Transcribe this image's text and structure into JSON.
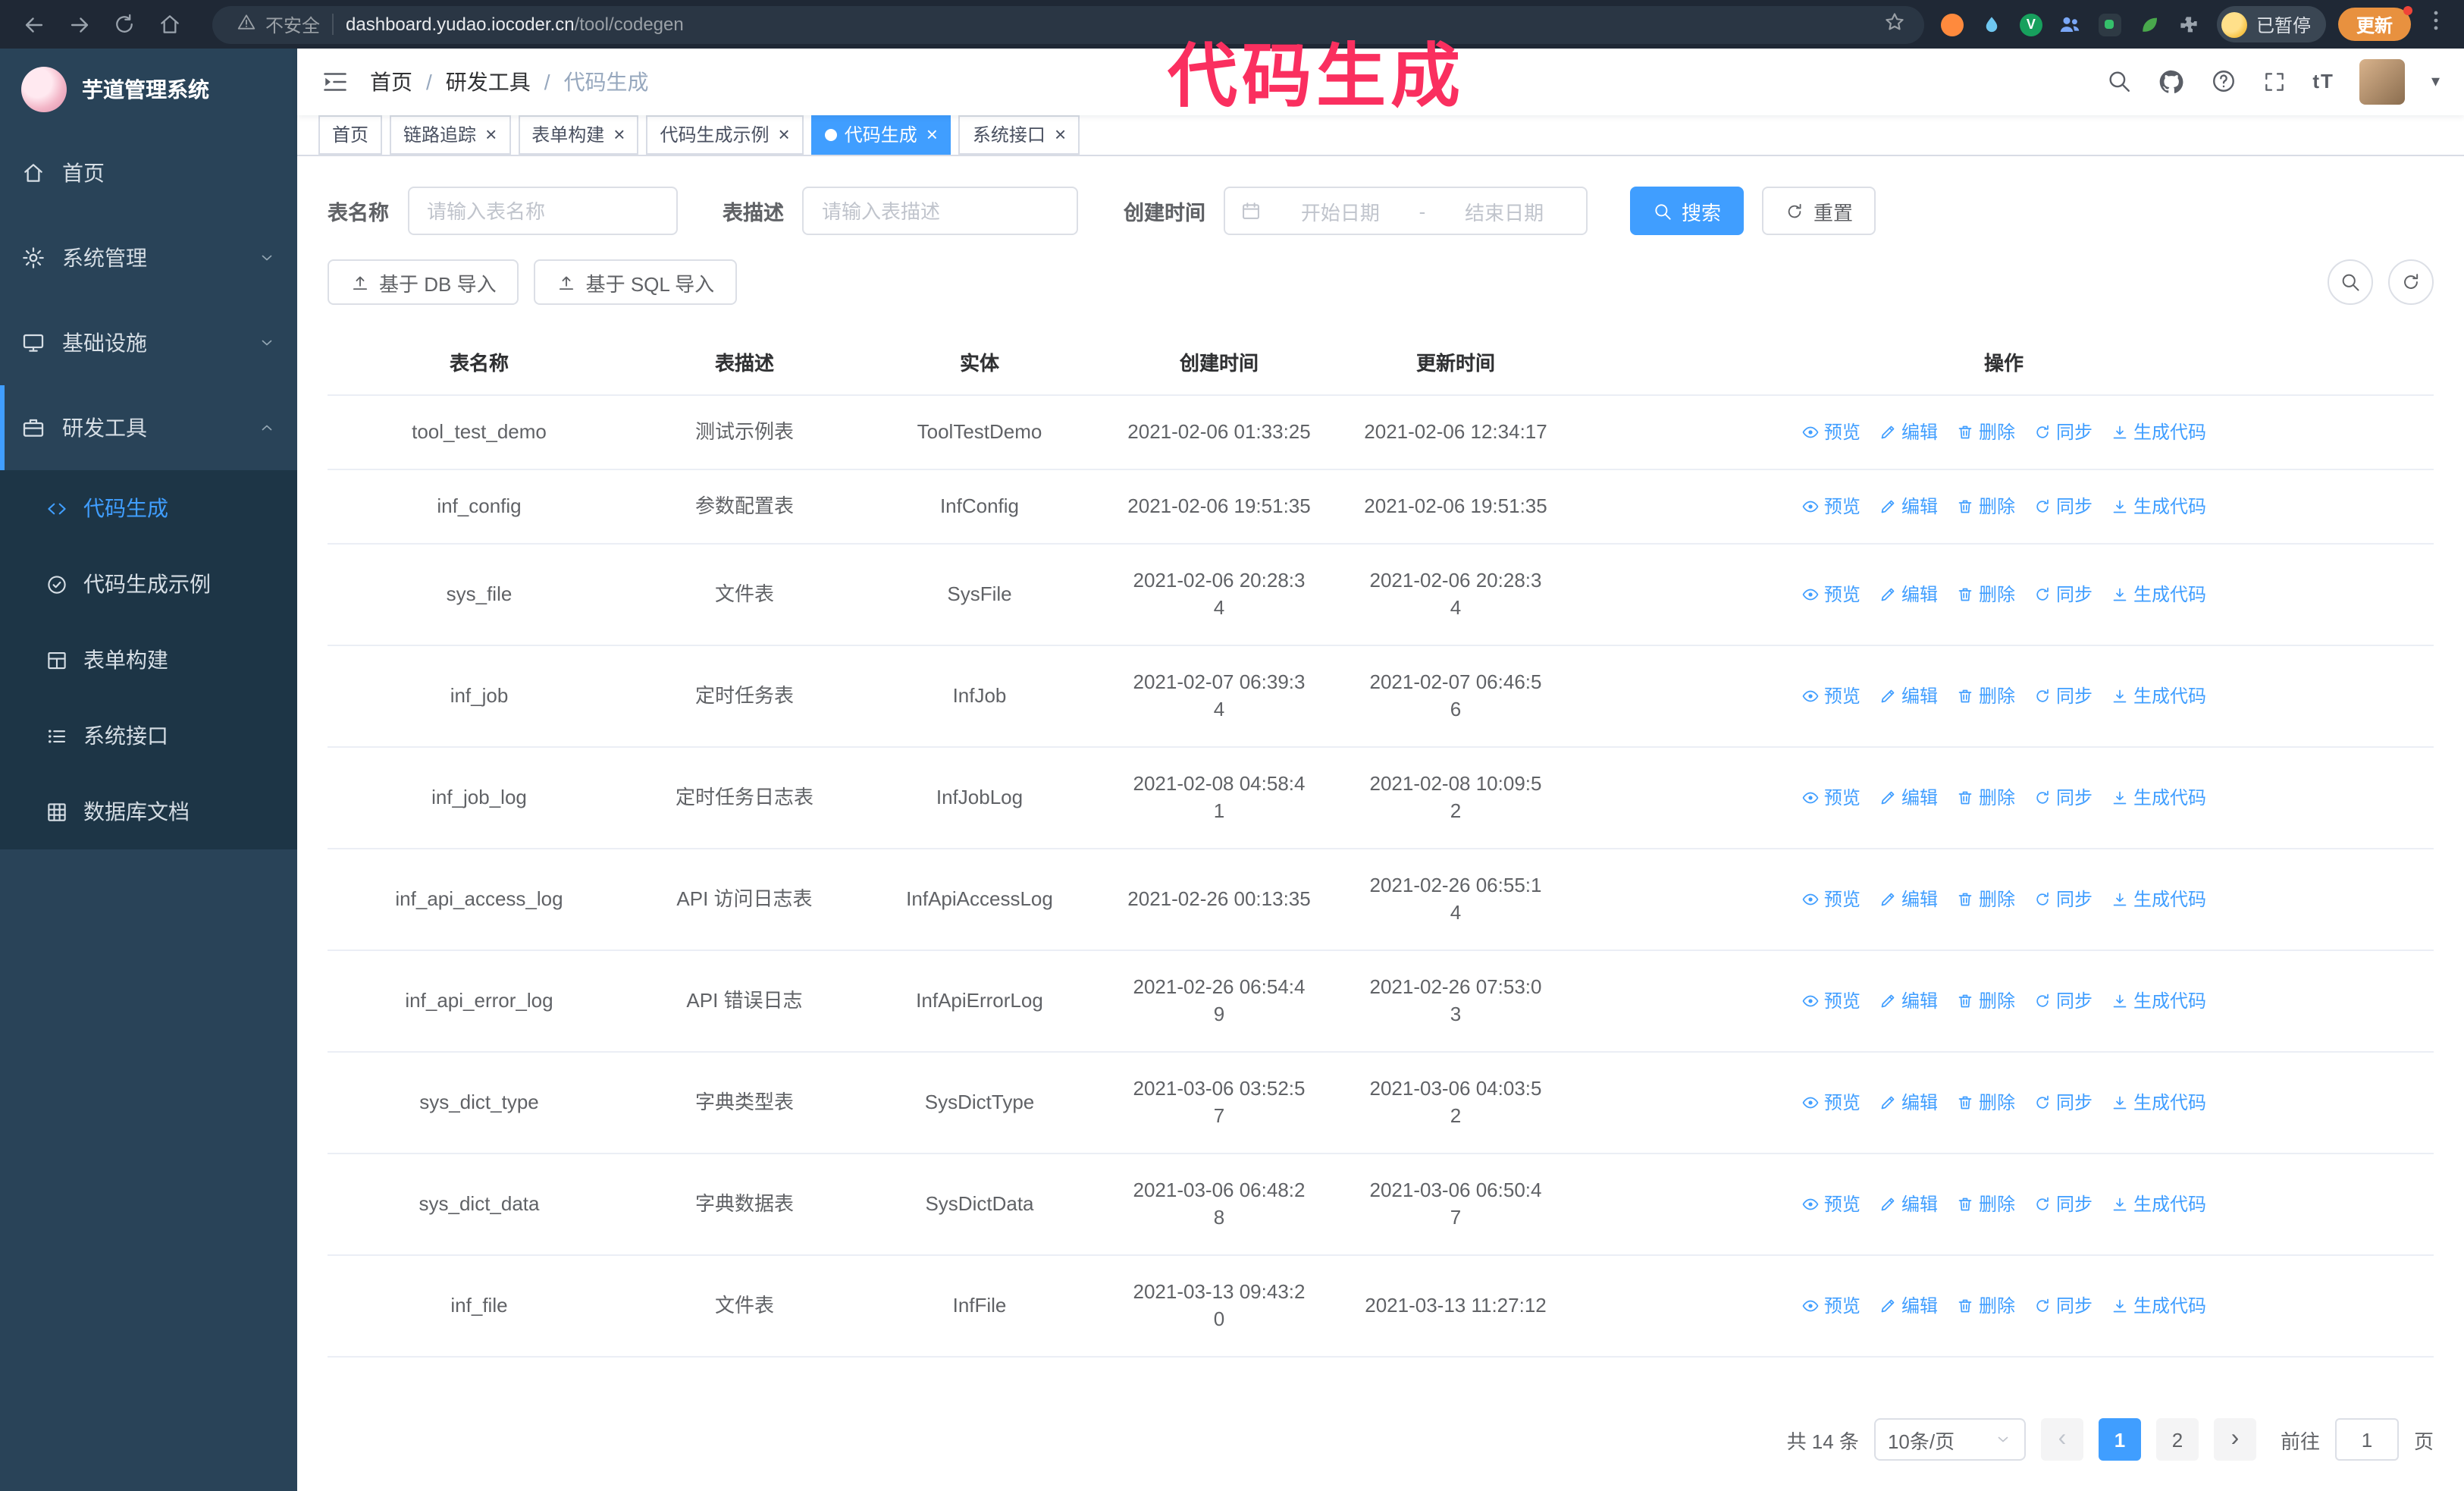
{
  "colors": {
    "accent": "#409eff",
    "annotation": "#fa2f5f",
    "update_button_bg": "#e8913f",
    "sidebar_bg": "#294358",
    "submenu_bg": "#1d3546"
  },
  "browser": {
    "security_label": "不安全",
    "url_host": "dashboard.yudao.iocoder.cn",
    "url_path": "/tool/codegen",
    "extension_icons": [
      "orange-circle-icon",
      "blue-drop-icon",
      "green-v-icon",
      "people-icon",
      "dark-card-icon",
      "leaf-icon",
      "puzzle-icon"
    ],
    "paused_badge": "已暂停",
    "update_button": "更新"
  },
  "annotation": {
    "text": "代码生成"
  },
  "sidebar": {
    "title": "芋道管理系统",
    "items": [
      {
        "label": "首页",
        "icon": "home"
      },
      {
        "label": "系统管理",
        "icon": "gear",
        "chevron": "down"
      },
      {
        "label": "基础设施",
        "icon": "monitor",
        "chevron": "down"
      },
      {
        "label": "研发工具",
        "icon": "briefcase",
        "chevron": "up",
        "active": true
      }
    ],
    "submenu": [
      {
        "label": "代码生成",
        "icon": "code",
        "active": true
      },
      {
        "label": "代码生成示例",
        "icon": "circle-check"
      },
      {
        "label": "表单构建",
        "icon": "form"
      },
      {
        "label": "系统接口",
        "icon": "api-list"
      },
      {
        "label": "数据库文档",
        "icon": "grid"
      }
    ]
  },
  "header": {
    "breadcrumb": [
      {
        "label": "首页"
      },
      {
        "label": "研发工具"
      },
      {
        "label": "代码生成",
        "current": true
      }
    ]
  },
  "tabs": [
    {
      "label": "首页",
      "closable": false,
      "active": false
    },
    {
      "label": "链路追踪",
      "closable": true,
      "active": false
    },
    {
      "label": "表单构建",
      "closable": true,
      "active": false
    },
    {
      "label": "代码生成示例",
      "closable": true,
      "active": false
    },
    {
      "label": "代码生成",
      "closable": true,
      "active": true
    },
    {
      "label": "系统接口",
      "closable": true,
      "active": false
    }
  ],
  "filters": {
    "table_name_label": "表名称",
    "table_name_placeholder": "请输入表名称",
    "table_desc_label": "表描述",
    "table_desc_placeholder": "请输入表描述",
    "create_time_label": "创建时间",
    "start_placeholder": "开始日期",
    "range_separator": "-",
    "end_placeholder": "结束日期",
    "search_button": "搜索",
    "reset_button": "重置"
  },
  "toolbar": {
    "import_db_label": "基于 DB 导入",
    "import_sql_label": "基于 SQL 导入"
  },
  "table": {
    "columns": [
      "表名称",
      "表描述",
      "实体",
      "创建时间",
      "更新时间",
      "操作"
    ],
    "action_labels": [
      "预览",
      "编辑",
      "删除",
      "同步",
      "生成代码"
    ],
    "rows": [
      {
        "name": "tool_test_demo",
        "desc": "测试示例表",
        "entity": "ToolTestDemo",
        "created": "2021-02-06 01:33:25",
        "updated": "2021-02-06 12:34:17"
      },
      {
        "name": "inf_config",
        "desc": "参数配置表",
        "entity": "InfConfig",
        "created": "2021-02-06 19:51:35",
        "updated": "2021-02-06 19:51:35"
      },
      {
        "name": "sys_file",
        "desc": "文件表",
        "entity": "SysFile",
        "created": "2021-02-06 20:28:3\n4",
        "updated": "2021-02-06 20:28:3\n4"
      },
      {
        "name": "inf_job",
        "desc": "定时任务表",
        "entity": "InfJob",
        "created": "2021-02-07 06:39:3\n4",
        "updated": "2021-02-07 06:46:5\n6"
      },
      {
        "name": "inf_job_log",
        "desc": "定时任务日志表",
        "entity": "InfJobLog",
        "created": "2021-02-08 04:58:4\n1",
        "updated": "2021-02-08 10:09:5\n2"
      },
      {
        "name": "inf_api_access_log",
        "desc": "API 访问日志表",
        "entity": "InfApiAccessLog",
        "created": "2021-02-26 00:13:35",
        "updated": "2021-02-26 06:55:1\n4"
      },
      {
        "name": "inf_api_error_log",
        "desc": "API 错误日志",
        "entity": "InfApiErrorLog",
        "created": "2021-02-26 06:54:4\n9",
        "updated": "2021-02-26 07:53:0\n3"
      },
      {
        "name": "sys_dict_type",
        "desc": "字典类型表",
        "entity": "SysDictType",
        "created": "2021-03-06 03:52:5\n7",
        "updated": "2021-03-06 04:03:5\n2"
      },
      {
        "name": "sys_dict_data",
        "desc": "字典数据表",
        "entity": "SysDictData",
        "created": "2021-03-06 06:48:2\n8",
        "updated": "2021-03-06 06:50:4\n7"
      },
      {
        "name": "inf_file",
        "desc": "文件表",
        "entity": "InfFile",
        "created": "2021-03-13 09:43:2\n0",
        "updated": "2021-03-13 11:27:12"
      }
    ]
  },
  "pagination": {
    "total_label": "共 14 条",
    "page_size_label": "10条/页",
    "pages": [
      "1",
      "2"
    ],
    "active_page": "1",
    "goto_label": "前往",
    "goto_value": "1",
    "page_unit": "页"
  }
}
